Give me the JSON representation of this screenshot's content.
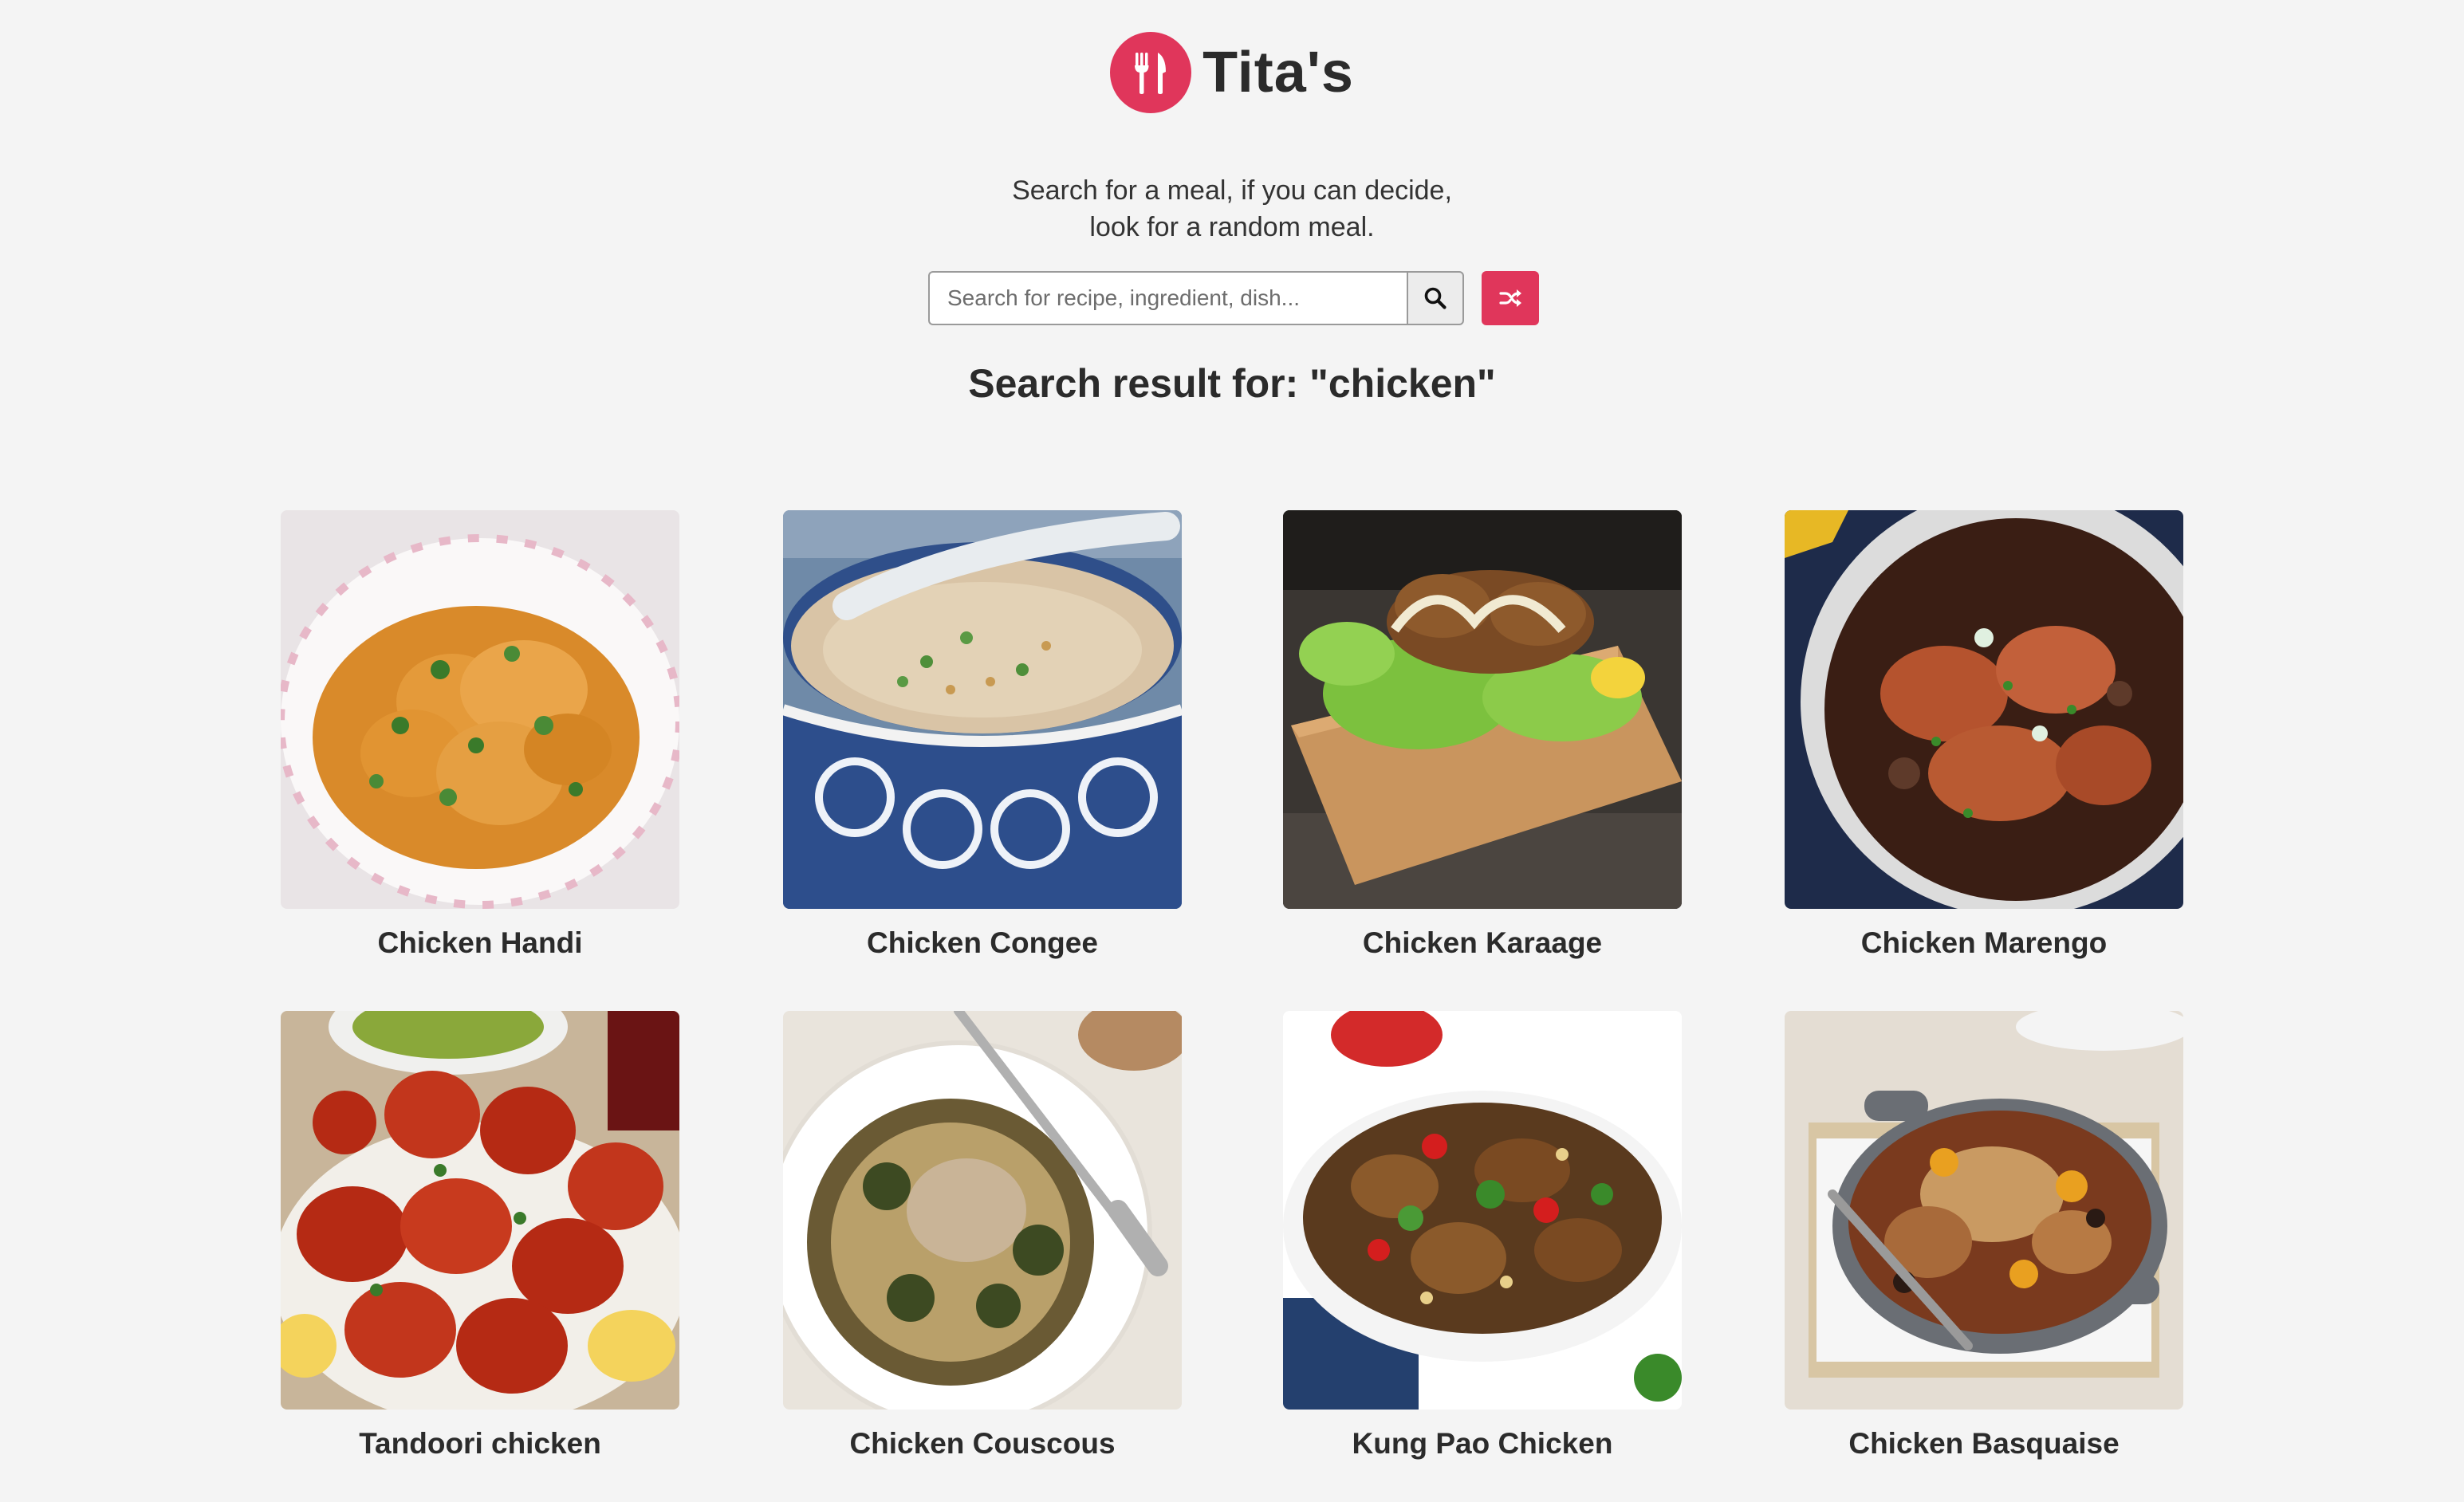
{
  "brand": {
    "name": "Tita's",
    "logo_icon": "fork-knife-icon",
    "accent_color": "#e0365b"
  },
  "tagline": {
    "line1": "Search for a meal, if you can decide,",
    "line2": "look for a random meal."
  },
  "search": {
    "placeholder": "Search for recipe, ingredient, dish...",
    "value": "",
    "search_icon": "search-icon",
    "random_icon": "shuffle-icon"
  },
  "results": {
    "prefix": "Search result for: ",
    "query": "\"chicken\""
  },
  "meals": [
    {
      "title": "Chicken Handi"
    },
    {
      "title": "Chicken Congee"
    },
    {
      "title": "Chicken Karaage"
    },
    {
      "title": "Chicken Marengo"
    },
    {
      "title": "Tandoori chicken"
    },
    {
      "title": "Chicken Couscous"
    },
    {
      "title": "Kung Pao Chicken"
    },
    {
      "title": "Chicken Basquaise"
    }
  ]
}
